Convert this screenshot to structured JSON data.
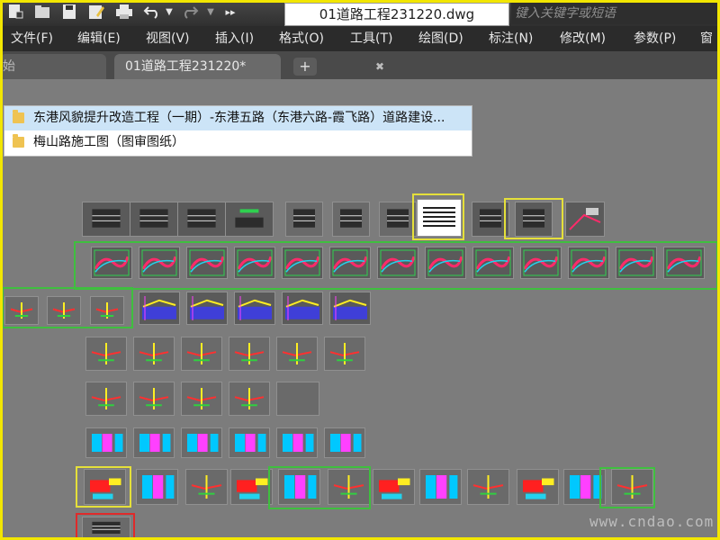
{
  "title_bar": {
    "document_title": "01道路工程231220.dwg",
    "search_placeholder": "键入关键字或短语",
    "overflow_glyph": "▸▸"
  },
  "menu": [
    {
      "id": "file",
      "label": "文件(F)"
    },
    {
      "id": "edit",
      "label": "编辑(E)"
    },
    {
      "id": "view",
      "label": "视图(V)"
    },
    {
      "id": "insert",
      "label": "插入(I)"
    },
    {
      "id": "format",
      "label": "格式(O)"
    },
    {
      "id": "tools",
      "label": "工具(T)"
    },
    {
      "id": "draw",
      "label": "绘图(D)"
    },
    {
      "id": "dimension",
      "label": "标注(N)"
    },
    {
      "id": "modify",
      "label": "修改(M)"
    },
    {
      "id": "parametric",
      "label": "参数(P)"
    },
    {
      "id": "window",
      "label": "窗"
    }
  ],
  "tabs": {
    "start_label": "始",
    "document_label": "01道路工程231220*",
    "close_glyph": "✖",
    "add_glyph": "+"
  },
  "folder_popup": [
    {
      "label": "东港风貌提升改造工程（一期）-东港五路（东港六路-霞飞路）道路建设..."
    },
    {
      "label": "梅山路施工图（图审图纸）"
    }
  ],
  "watermark": "www.cndao.com",
  "colors": {
    "accent_frame": "#f2e600",
    "highlight_yellow": "#e5e03a",
    "highlight_green": "#3fbf3f",
    "highlight_red": "#e02a2a",
    "canvas": "#7c7c7c"
  },
  "icons": [
    "new-file-icon",
    "open-folder-icon",
    "save-icon",
    "save-as-icon",
    "print-icon",
    "undo-icon",
    "redo-icon",
    "folder-icon",
    "close-icon",
    "plus-icon"
  ]
}
